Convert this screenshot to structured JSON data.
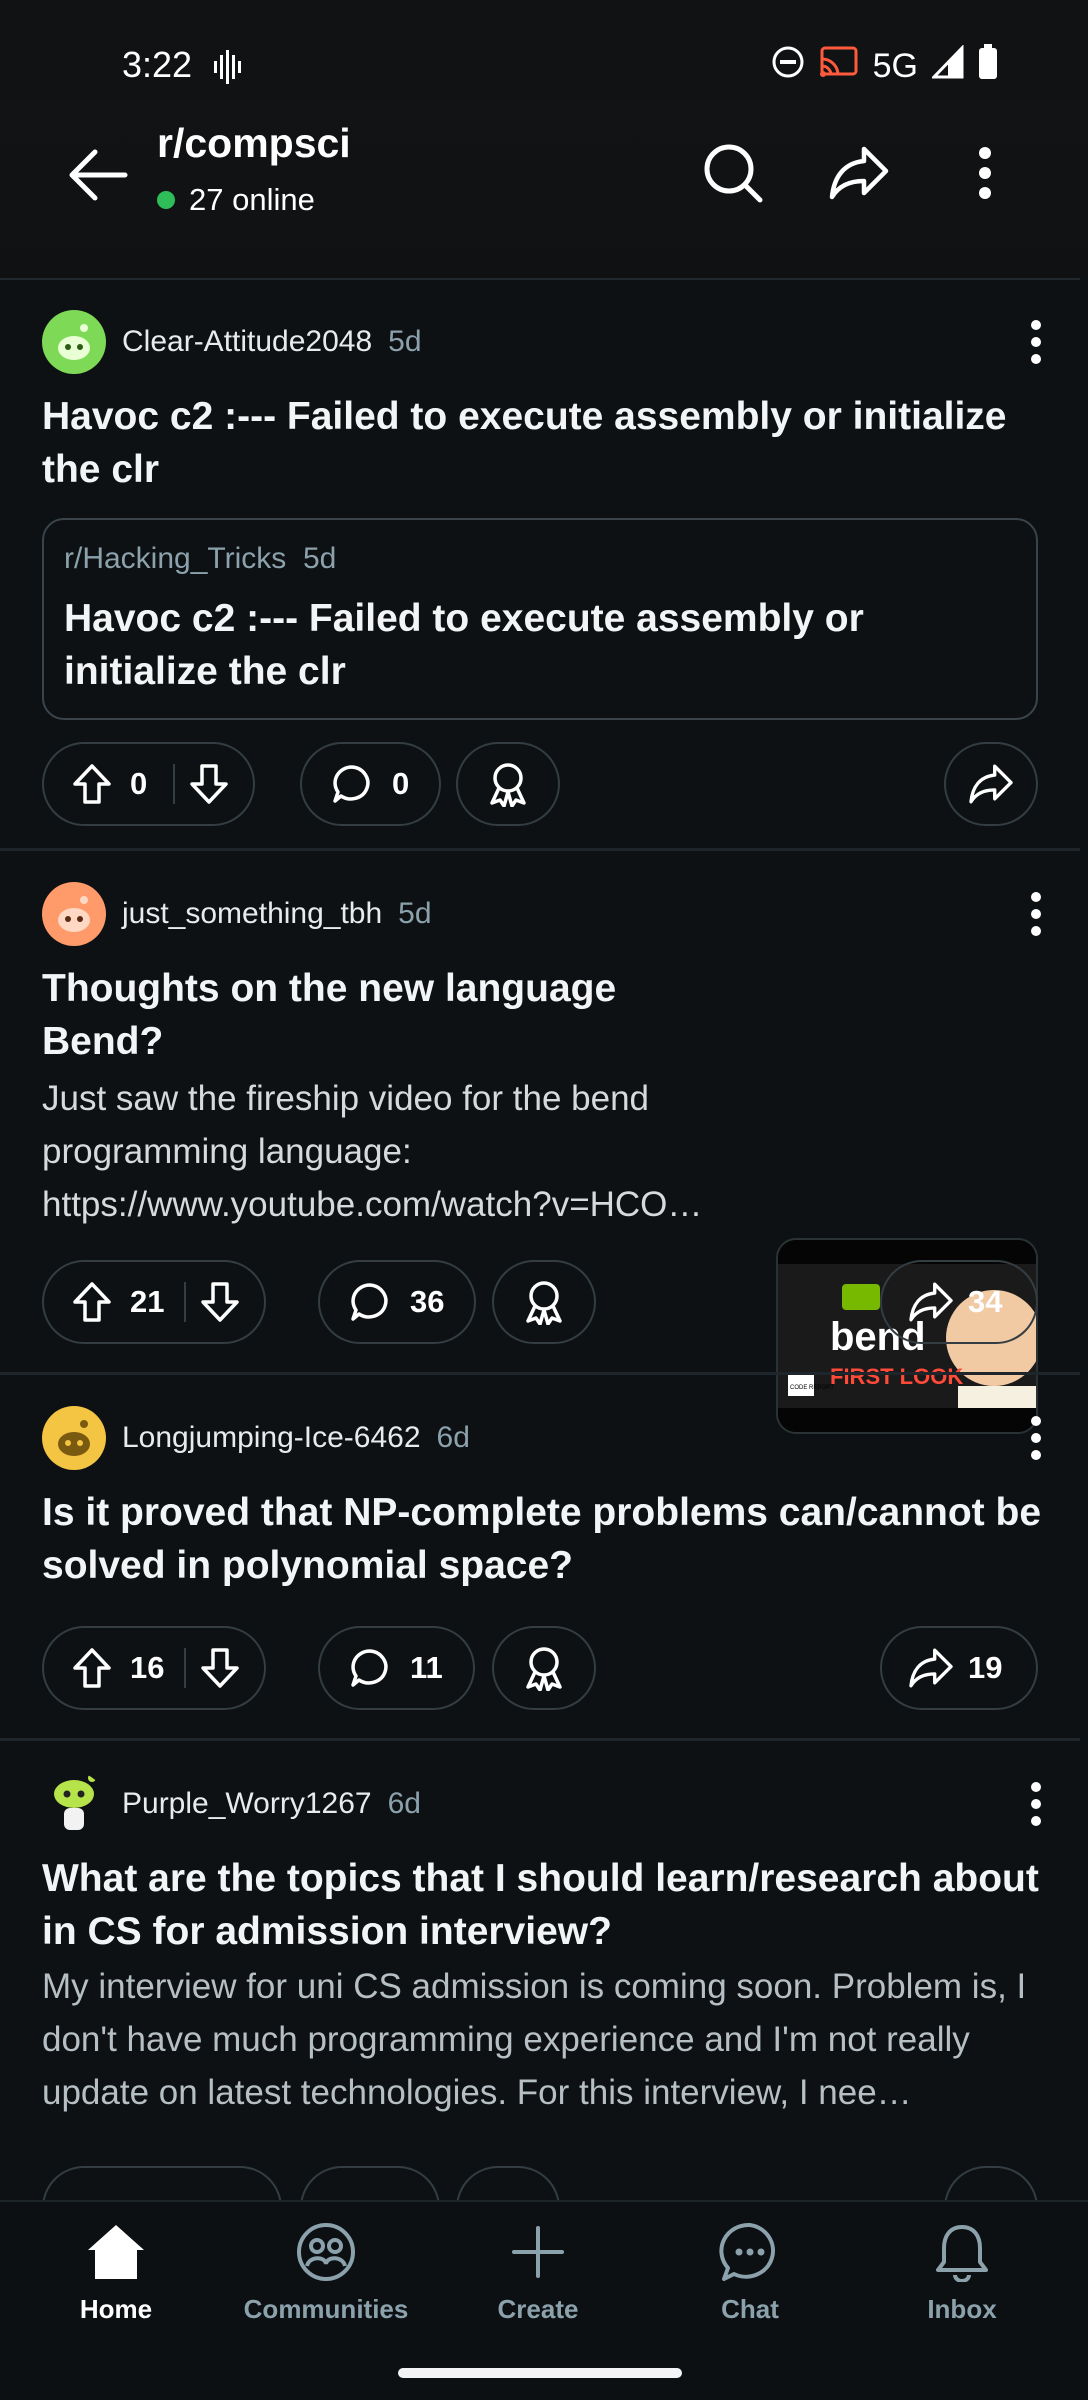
{
  "status_bar": {
    "time": "3:22",
    "network": "5G"
  },
  "header": {
    "title": "r/compsci",
    "online": "27 online"
  },
  "posts": [
    {
      "author": "Clear-Attitude2048",
      "age": "5d",
      "title": "Havoc c2 :--- Failed to execute assembly or initialize the clr",
      "crosspost": {
        "subreddit": "r/Hacking_Tricks",
        "age": "5d",
        "title": "Havoc c2 :--- Failed to execute assembly or initialize the clr"
      },
      "votes": "0",
      "comments": "0",
      "shares": ""
    },
    {
      "author": "just_something_tbh",
      "age": "5d",
      "title": "Thoughts on the new language Bend?",
      "body": "Just saw the fireship video for the bend programming language: https://www.youtube.com/watch?v=HCO…",
      "thumbnail": {
        "word": "bend",
        "caption": "FIRST LOOK",
        "badge": "CODE REPORT"
      },
      "votes": "21",
      "comments": "36",
      "shares": "34"
    },
    {
      "author": "Longjumping-Ice-6462",
      "age": "6d",
      "title": "Is it proved that NP-complete problems can/cannot be solved in polynomial space?",
      "votes": "16",
      "comments": "11",
      "shares": "19"
    },
    {
      "author": "Purple_Worry1267",
      "age": "6d",
      "title": "What are the topics that I should learn/research about in CS for admission interview?",
      "body": "My interview for uni CS admission is coming soon. Problem is, I don't have much programming experience and I'm not really update on latest technologies. For this interview, I nee…"
    }
  ],
  "nav": {
    "home": "Home",
    "communities": "Communities",
    "create": "Create",
    "chat": "Chat",
    "inbox": "Inbox"
  },
  "colors": {
    "background": "#0e1113",
    "online_dot": "#2ebd59",
    "border": "#333d42",
    "muted_text": "#8ba2ad"
  }
}
